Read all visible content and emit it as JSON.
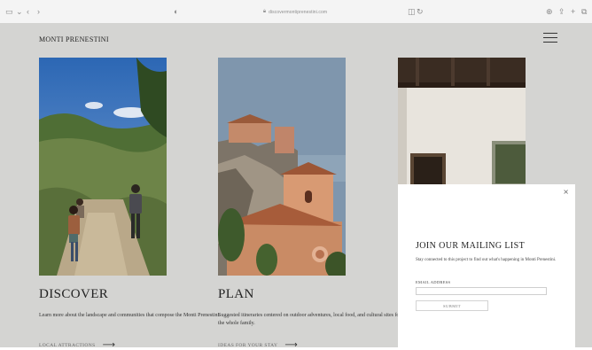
{
  "browser": {
    "url": "discovermontiprenestini.com",
    "icons": [
      "sidebar-icon",
      "back-icon",
      "forward-icon",
      "shield-icon",
      "reload-icon",
      "download-icon",
      "share-icon",
      "add-tab-icon",
      "tabs-icon"
    ]
  },
  "site": {
    "logo": "MONTI PRENESTINI"
  },
  "cards": [
    {
      "title": "DISCOVER",
      "description": "Learn more about the landscape and communities that compose the Monti Prenestini.",
      "link": "LOCAL ATTRACTIONS"
    },
    {
      "title": "PLAN",
      "description": "Suggested itineraries centered on outdoor adventures, local food, and cultural sites for the whole family.",
      "link": "IDEAS FOR YOUR STAY"
    },
    {
      "title": "",
      "description": "",
      "link": ""
    }
  ],
  "popup": {
    "close": "×",
    "title": "JOIN OUR MAILING LIST",
    "description": "Stay connected to this project to find out what's happening in Monti Prenestini.",
    "email_label": "EMAIL ADDRESS",
    "email_value": "",
    "submit_label": "SUBMIT"
  },
  "colors": {
    "page_background": "#d4d4d2",
    "popup_background": "#ffffff",
    "text": "#222222"
  }
}
